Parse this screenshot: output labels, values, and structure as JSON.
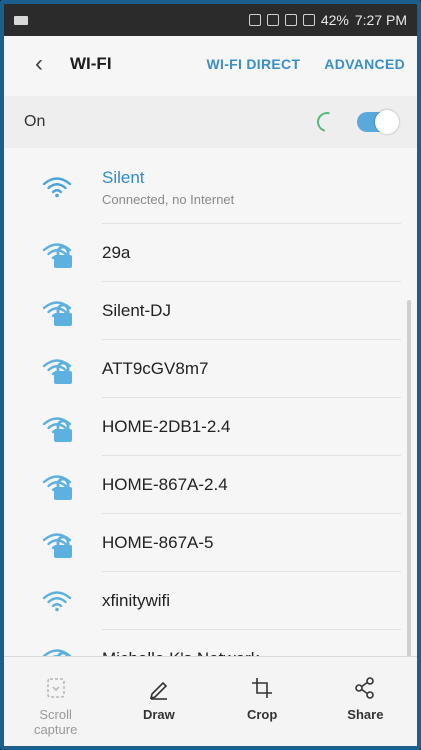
{
  "status_bar": {
    "battery": "42%",
    "time": "7:27 PM"
  },
  "header": {
    "title": "WI-FI",
    "wifi_direct": "WI-FI DIRECT",
    "advanced": "ADVANCED"
  },
  "wifi_toggle": {
    "label": "On",
    "state": "on",
    "accent_color": "#5aa9db"
  },
  "networks": [
    {
      "name": "Silent",
      "status": "Connected, no Internet",
      "secured": false,
      "active": true
    },
    {
      "name": "29a",
      "secured": true
    },
    {
      "name": "Silent-DJ",
      "secured": true
    },
    {
      "name": "ATT9cGV8m7",
      "secured": true
    },
    {
      "name": "HOME-2DB1-2.4",
      "secured": true
    },
    {
      "name": "HOME-867A-2.4",
      "secured": true
    },
    {
      "name": "HOME-867A-5",
      "secured": true
    },
    {
      "name": "xfinitywifi",
      "secured": false
    },
    {
      "name": "Michelle K's Network",
      "secured": true
    }
  ],
  "toolbar": {
    "scroll_capture": "Scroll capture",
    "draw": "Draw",
    "crop": "Crop",
    "share": "Share"
  }
}
